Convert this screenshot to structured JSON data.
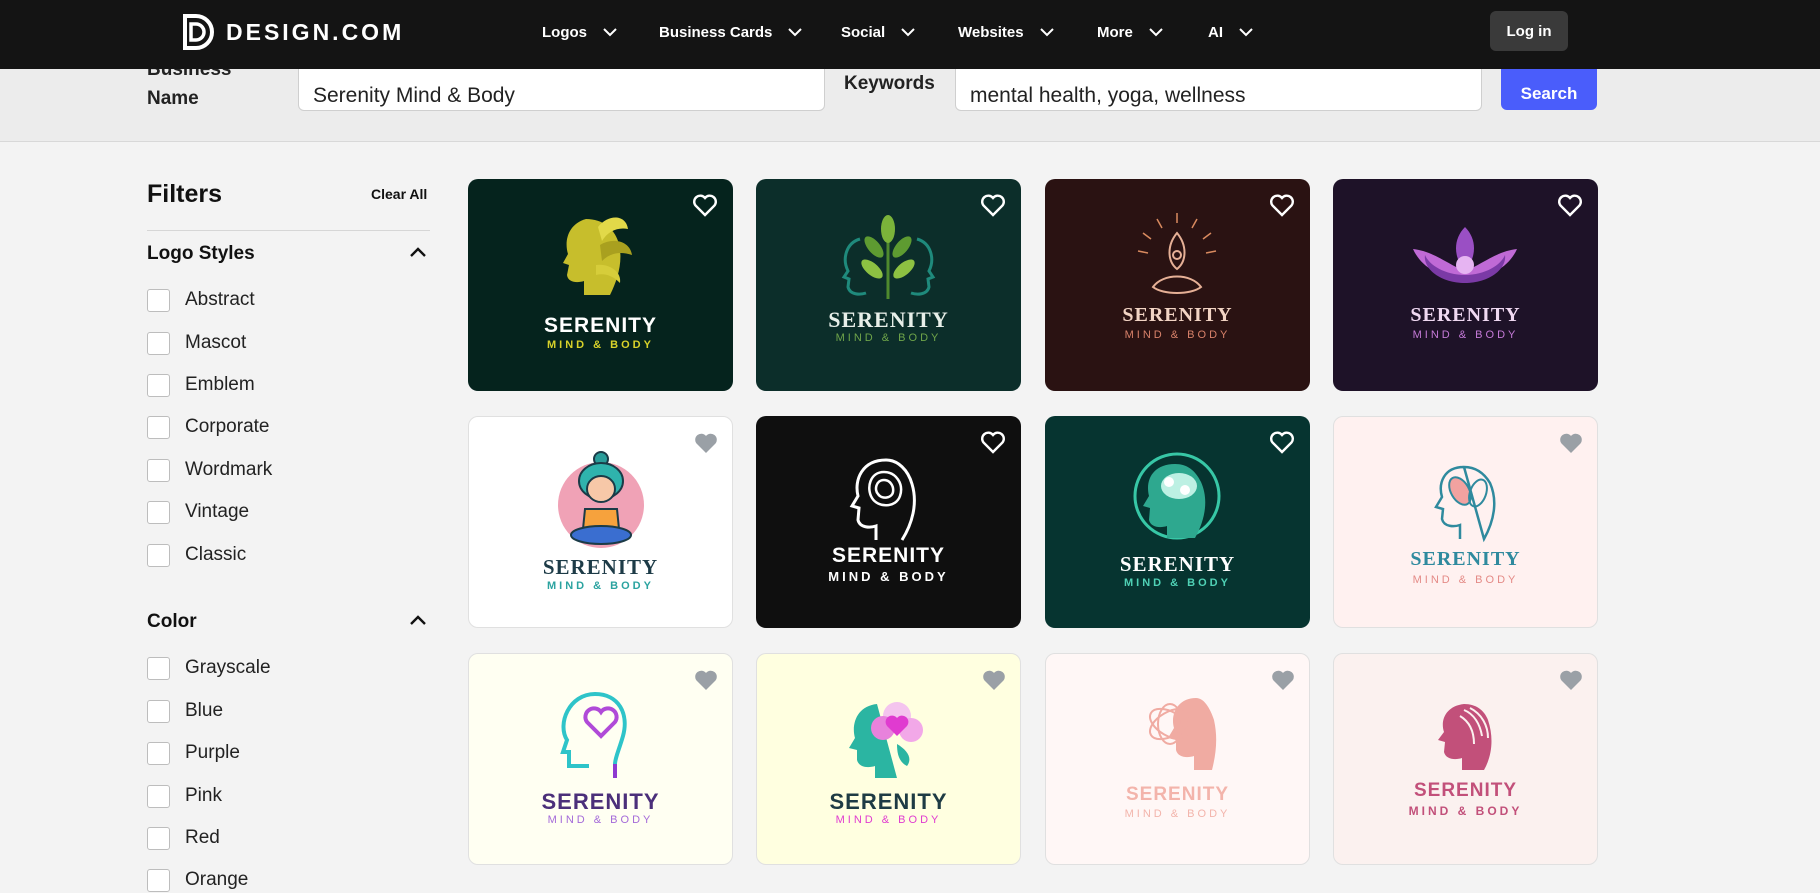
{
  "header": {
    "brand": "DESIGN.COM",
    "nav": [
      {
        "label": "Logos"
      },
      {
        "label": "Business Cards"
      },
      {
        "label": "Social"
      },
      {
        "label": "Websites"
      },
      {
        "label": "More"
      },
      {
        "label": "AI"
      }
    ],
    "login_label": "Log in"
  },
  "search": {
    "business_name_label": "Business Name",
    "business_name_value": "Serenity Mind & Body",
    "keywords_label": "Keywords",
    "keywords_value": "mental health, yoga, wellness",
    "search_label": "Search"
  },
  "filters": {
    "title": "Filters",
    "clear_all": "Clear All",
    "logo_styles": {
      "title": "Logo Styles",
      "options": [
        "Abstract",
        "Mascot",
        "Emblem",
        "Corporate",
        "Wordmark",
        "Vintage",
        "Classic"
      ]
    },
    "color": {
      "title": "Color",
      "options": [
        "Grayscale",
        "Blue",
        "Purple",
        "Pink",
        "Red",
        "Orange"
      ]
    }
  },
  "results": [
    {
      "name": "SERENITY",
      "tagline": "MIND & BODY",
      "bg": "#05231d",
      "name_color": "#ffffff",
      "tag_color": "#d8d22a",
      "icon": "leaf-head-icon"
    },
    {
      "name": "SERENITY",
      "tagline": "MIND & BODY",
      "bg": "#0c2e2a",
      "name_color": "#e8efe9",
      "tag_color": "#6fa54a",
      "icon": "twin-faces-leaves-icon"
    },
    {
      "name": "SERENITY",
      "tagline": "MIND & BODY",
      "bg": "#2a1212",
      "name_color": "#f2d4c4",
      "tag_color": "#d9826a",
      "icon": "meditation-sun-icon"
    },
    {
      "name": "SERENITY",
      "tagline": "MIND & BODY",
      "bg": "#1e1228",
      "name_color": "#f0d9f2",
      "tag_color": "#c57ad8",
      "icon": "lotus-icon"
    },
    {
      "name": "SERENITY",
      "tagline": "MIND & BODY",
      "bg": "#ffffff",
      "name_color": "#1d3b47",
      "tag_color": "#2ba3a0",
      "icon": "meditating-girl-icon"
    },
    {
      "name": "SERENITY",
      "tagline": "MIND & BODY",
      "bg": "#0f0f0f",
      "name_color": "#ffffff",
      "tag_color": "#ffffff",
      "icon": "maze-head-icon"
    },
    {
      "name": "SERENITY",
      "tagline": "MIND & BODY",
      "bg": "#063430",
      "name_color": "#ffffff",
      "tag_color": "#4fd1b5",
      "icon": "brain-head-icon"
    },
    {
      "name": "SERENITY",
      "tagline": "MIND & BODY",
      "bg": "#fff1f0",
      "name_color": "#2f8a9e",
      "tag_color": "#e48a86",
      "icon": "leaf-brain-profile-icon"
    },
    {
      "name": "SERENITY",
      "tagline": "MIND & BODY",
      "bg": "#fffff2",
      "name_color": "#4b2f7a",
      "tag_color": "#a46ad9",
      "icon": "heart-head-icon"
    },
    {
      "name": "SERENITY",
      "tagline": "MIND & BODY",
      "bg": "#ffffe0",
      "name_color": "#1e3b44",
      "tag_color": "#e03bd0",
      "icon": "heart-flower-head-icon"
    },
    {
      "name": "SERENITY",
      "tagline": "MIND & BODY",
      "bg": "#fff7f6",
      "name_color": "#f3b4ab",
      "tag_color": "#f3b4ab",
      "icon": "tangled-head-icon"
    },
    {
      "name": "SERENITY",
      "tagline": "MIND & BODY",
      "bg": "#fbf1ef",
      "name_color": "#c2507a",
      "tag_color": "#c2507a",
      "icon": "flowing-hair-head-icon"
    }
  ]
}
